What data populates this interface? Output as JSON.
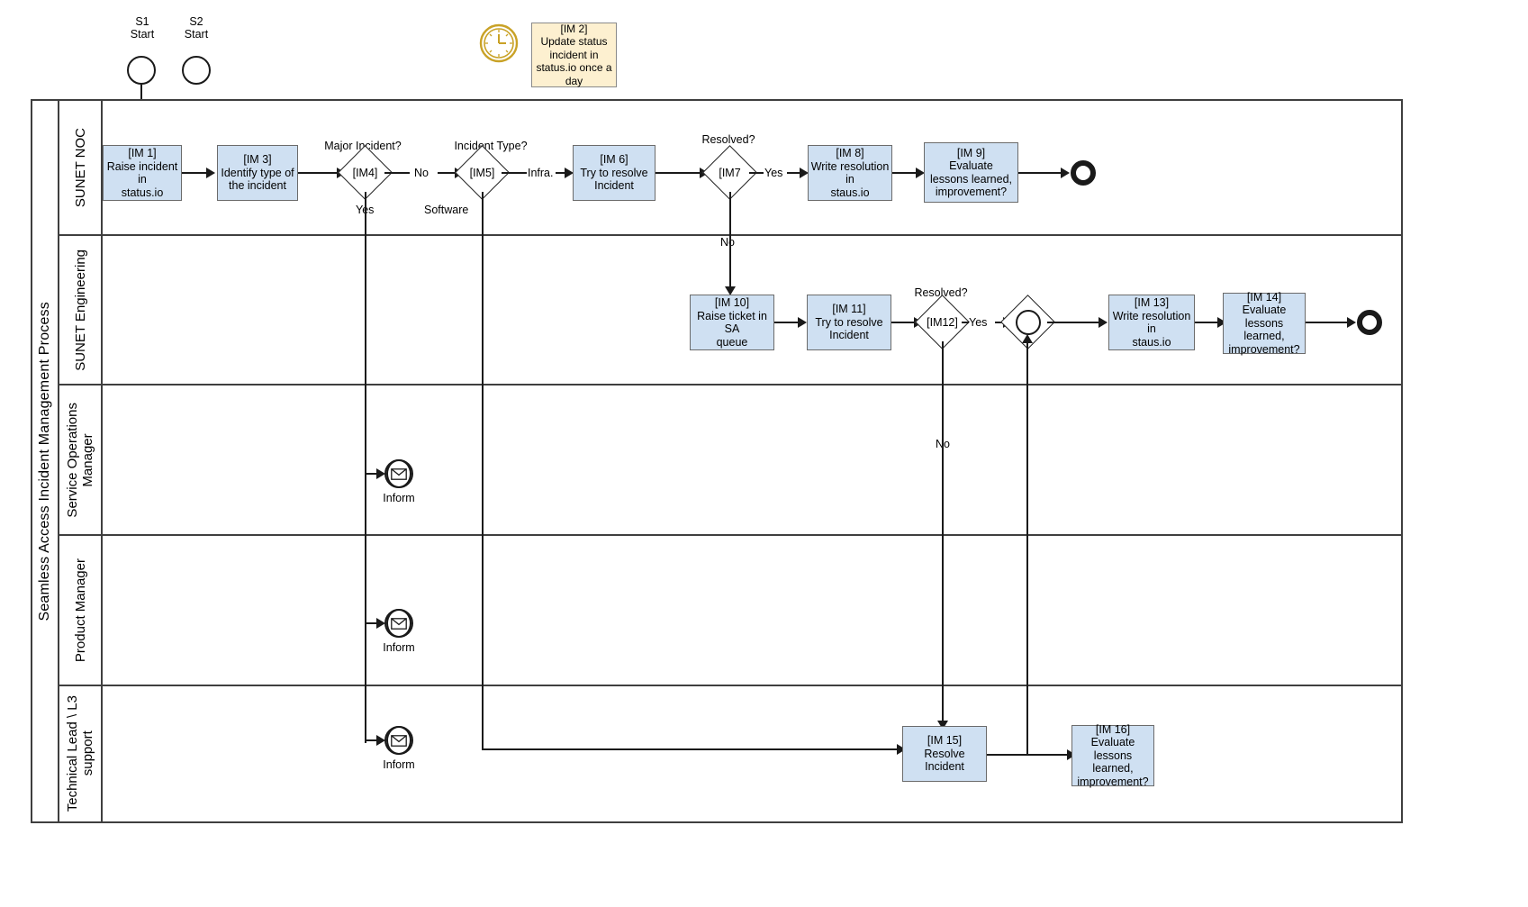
{
  "pool": {
    "title": "Seamless Access Incident Management Process"
  },
  "lanes": [
    {
      "id": "lane-sunet-noc",
      "label": "SUNET NOC"
    },
    {
      "id": "lane-sunet-engineering",
      "label": "SUNET Engineering"
    },
    {
      "id": "lane-service-ops-manager",
      "label": "Service Operations\nManager"
    },
    {
      "id": "lane-product-manager",
      "label": "Product Manager"
    },
    {
      "id": "lane-technical-lead",
      "label": "Technical Lead \\ L3\nsupport"
    }
  ],
  "start_events": [
    {
      "id": "s1",
      "label": "S1\nStart"
    },
    {
      "id": "s2",
      "label": "S2\nStart"
    }
  ],
  "timer_note": {
    "icon": "clock-icon",
    "text": "[IM 2]\nUpdate status\nincident in\nstatus.io once a\nday"
  },
  "tasks": [
    {
      "id": "im1",
      "text": "[IM 1]\nRaise incident in\nstatus.io"
    },
    {
      "id": "im3",
      "text": "[IM 3]\nIdentify type of\nthe incident"
    },
    {
      "id": "im6",
      "text": "[IM 6]\nTry to resolve\nIncident"
    },
    {
      "id": "im8",
      "text": "[IM 8]\nWrite resolution in\nstaus.io"
    },
    {
      "id": "im9",
      "text": "[IM 9]\nEvaluate\nlessons learned,\nimprovement?"
    },
    {
      "id": "im10",
      "text": "[IM 10]\nRaise ticket in SA\nqueue"
    },
    {
      "id": "im11",
      "text": "[IM 11]\nTry to resolve\nIncident"
    },
    {
      "id": "im13",
      "text": "[IM 13]\nWrite resolution in\nstaus.io"
    },
    {
      "id": "im14",
      "text": "[IM 14]\nEvaluate\nlessons learned,\nimprovement?"
    },
    {
      "id": "im15",
      "text": "[IM 15]\nResolve Incident"
    },
    {
      "id": "im16",
      "text": "[IM 16]\nEvaluate\nlessons learned,\nimprovement?"
    }
  ],
  "gateways": [
    {
      "id": "im4",
      "label": "[IM4]",
      "caption": "Major Incident?"
    },
    {
      "id": "im5",
      "label": "[IM5]",
      "caption": "Incident Type?"
    },
    {
      "id": "im7",
      "label": "[IM7",
      "caption": "Resolved?"
    },
    {
      "id": "im12",
      "label": "[IM12]",
      "caption": "Resolved?"
    },
    {
      "id": "merge",
      "label": "",
      "caption": ""
    }
  ],
  "flow_labels": {
    "im4_no": "No",
    "im4_yes": "Yes",
    "im5_infra": "Infra.",
    "im5_software": "Software",
    "im7_yes": "Yes",
    "im7_no": "No",
    "im12_yes": "Yes",
    "im12_no": "No"
  },
  "message_events": [
    {
      "id": "inform-service-ops",
      "icon": "envelope-icon",
      "label": "Inform"
    },
    {
      "id": "inform-product-mgr",
      "icon": "envelope-icon",
      "label": "Inform"
    },
    {
      "id": "inform-tech-lead",
      "icon": "envelope-icon",
      "label": "Inform"
    }
  ],
  "end_events": [
    {
      "id": "end-noc"
    },
    {
      "id": "end-eng"
    }
  ],
  "colors": {
    "task_fill": "#cfe0f2",
    "task_stroke": "#6b6b6b",
    "note_fill": "#fdf0d0",
    "note_stroke": "#8a8a8a",
    "line": "#1a1a1a",
    "pool_stroke": "#3f3f3f",
    "timer_gold": "#c9a227"
  }
}
